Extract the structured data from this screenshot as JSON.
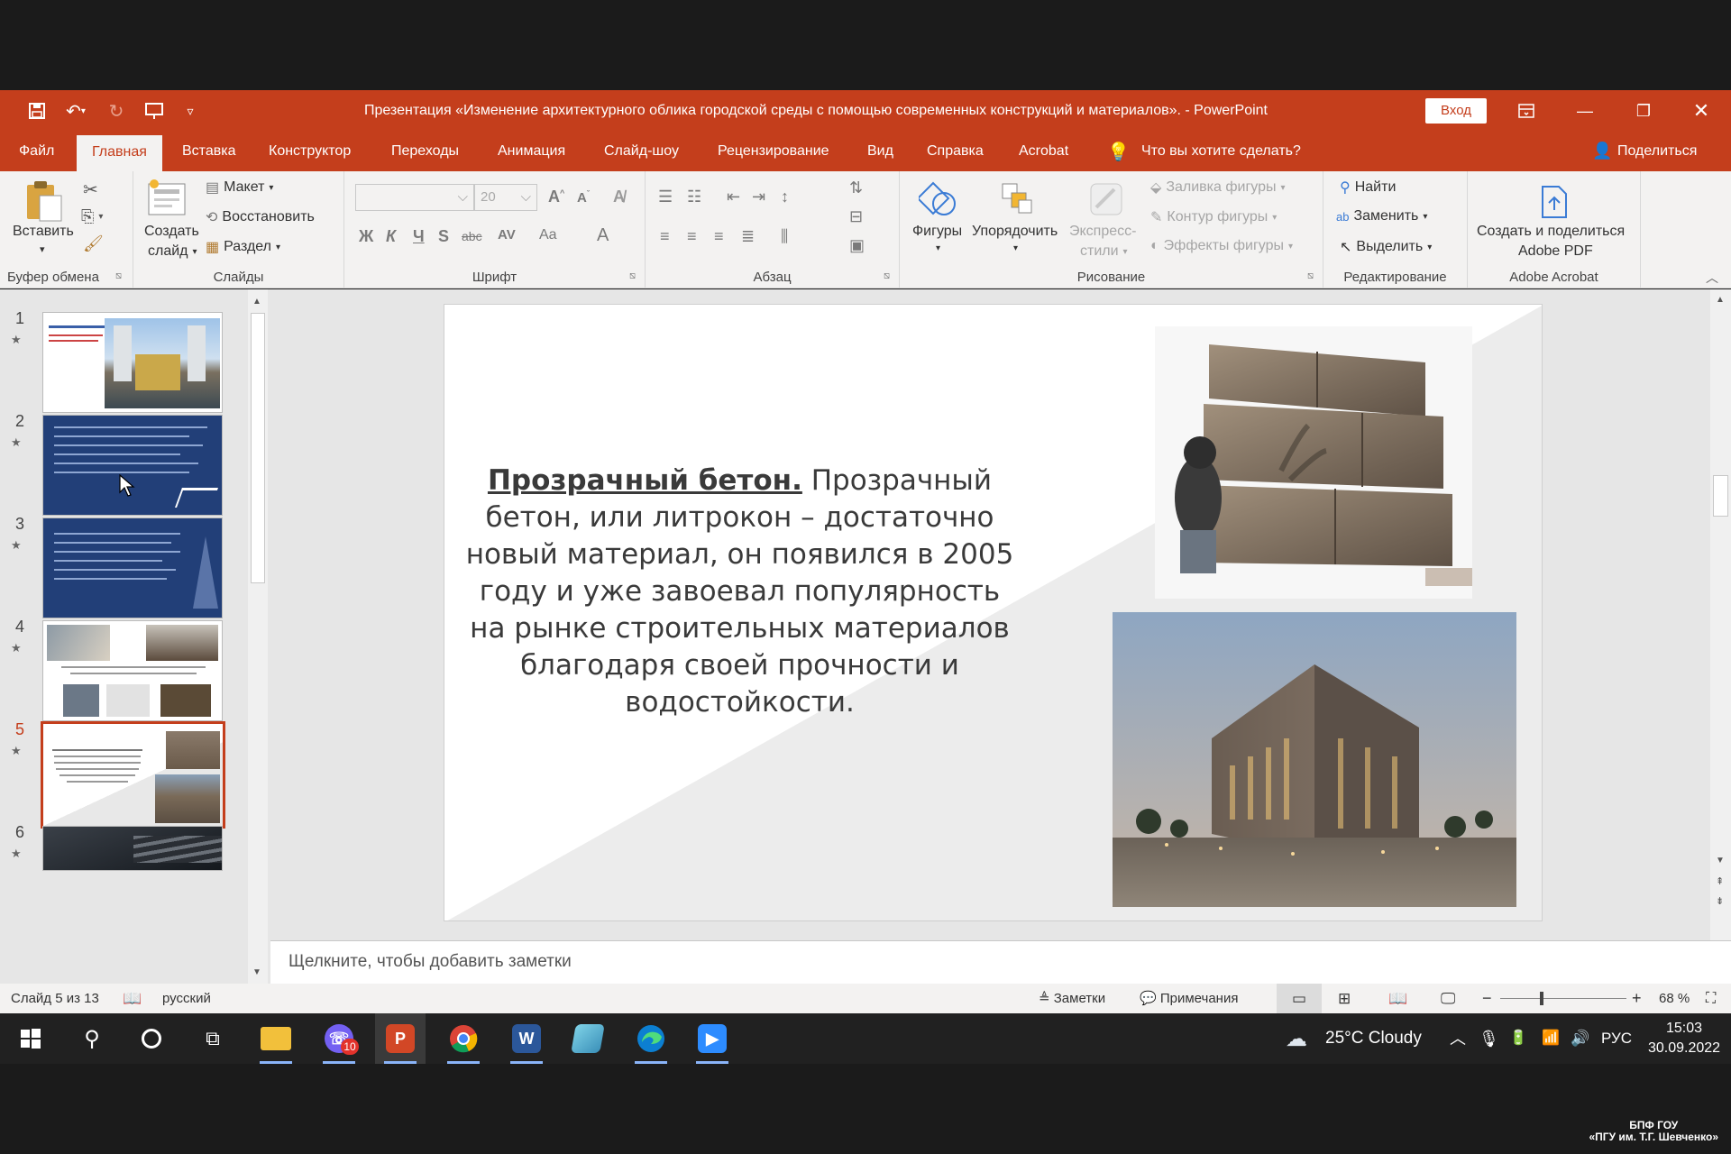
{
  "window": {
    "title": "Презентация «Изменение архитектурного облика городской среды с помощью современных конструкций и материалов».  -  PowerPoint",
    "signin": "Вход"
  },
  "tabs": [
    {
      "label": "Файл"
    },
    {
      "label": "Главная"
    },
    {
      "label": "Вставка"
    },
    {
      "label": "Конструктор"
    },
    {
      "label": "Переходы"
    },
    {
      "label": "Анимация"
    },
    {
      "label": "Слайд-шоу"
    },
    {
      "label": "Рецензирование"
    },
    {
      "label": "Вид"
    },
    {
      "label": "Справка"
    },
    {
      "label": "Acrobat"
    }
  ],
  "tellme": "Что вы хотите сделать?",
  "share": "Поделиться",
  "ribbon": {
    "clipboard": {
      "paste": "Вставить",
      "label": "Буфер обмена"
    },
    "slides": {
      "new_slide_1": "Создать",
      "new_slide_2": "слайд",
      "layout": "Макет",
      "reset": "Восстановить",
      "section": "Раздел",
      "label": "Слайды"
    },
    "font": {
      "size": "20",
      "label": "Шрифт",
      "bold": "Ж",
      "italic": "К",
      "underline": "Ч",
      "shadow": "S",
      "strike": "abc",
      "spacing": "AV",
      "case": "Aa",
      "color": "A"
    },
    "paragraph": {
      "label": "Абзац"
    },
    "drawing": {
      "shapes": "Фигуры",
      "arrange": "Упорядочить",
      "quick_styles_1": "Экспресс-",
      "quick_styles_2": "стили",
      "fill": "Заливка фигуры",
      "outline": "Контур фигуры",
      "effects": "Эффекты фигуры",
      "label": "Рисование"
    },
    "editing": {
      "find": "Найти",
      "replace": "Заменить",
      "select": "Выделить",
      "label": "Редактирование"
    },
    "acrobat": {
      "create_1": "Создать и поделиться",
      "create_2": "Adobe PDF",
      "label": "Adobe Acrobat"
    }
  },
  "thumbnails": [
    {
      "num": "1",
      "star": "★"
    },
    {
      "num": "2",
      "star": "★"
    },
    {
      "num": "3",
      "star": "★"
    },
    {
      "num": "4",
      "star": "★"
    },
    {
      "num": "5",
      "star": "★"
    },
    {
      "num": "6",
      "star": "★"
    }
  ],
  "slide": {
    "heading": "Прозрачный бетон.",
    "body": " Прозрачный бетон, или литрокон – достаточно новый материал, он появился в 2005 году и уже завоевал популярность на рынке строительных материалов благодаря своей прочности и водостойкости."
  },
  "notes_placeholder": "Щелкните, чтобы добавить заметки",
  "status": {
    "slide_pos": "Слайд 5 из 13",
    "language": "русский",
    "notes": "Заметки",
    "comments": "Примечания",
    "zoom": "68 %"
  },
  "taskbar": {
    "viber_badge": "10",
    "weather": "25°C  Cloudy",
    "lang": "РУС",
    "time": "15:03",
    "date": "30.09.2022"
  },
  "watermark": {
    "line1": "БПФ ГОУ",
    "line2": "«ПГУ им. Т.Г. Шевченко»"
  },
  "colors": {
    "accent": "#c43e1c",
    "ribbon_bg": "#f3f2f1",
    "workspace": "#e6e6e6",
    "taskbar": "#212121"
  }
}
